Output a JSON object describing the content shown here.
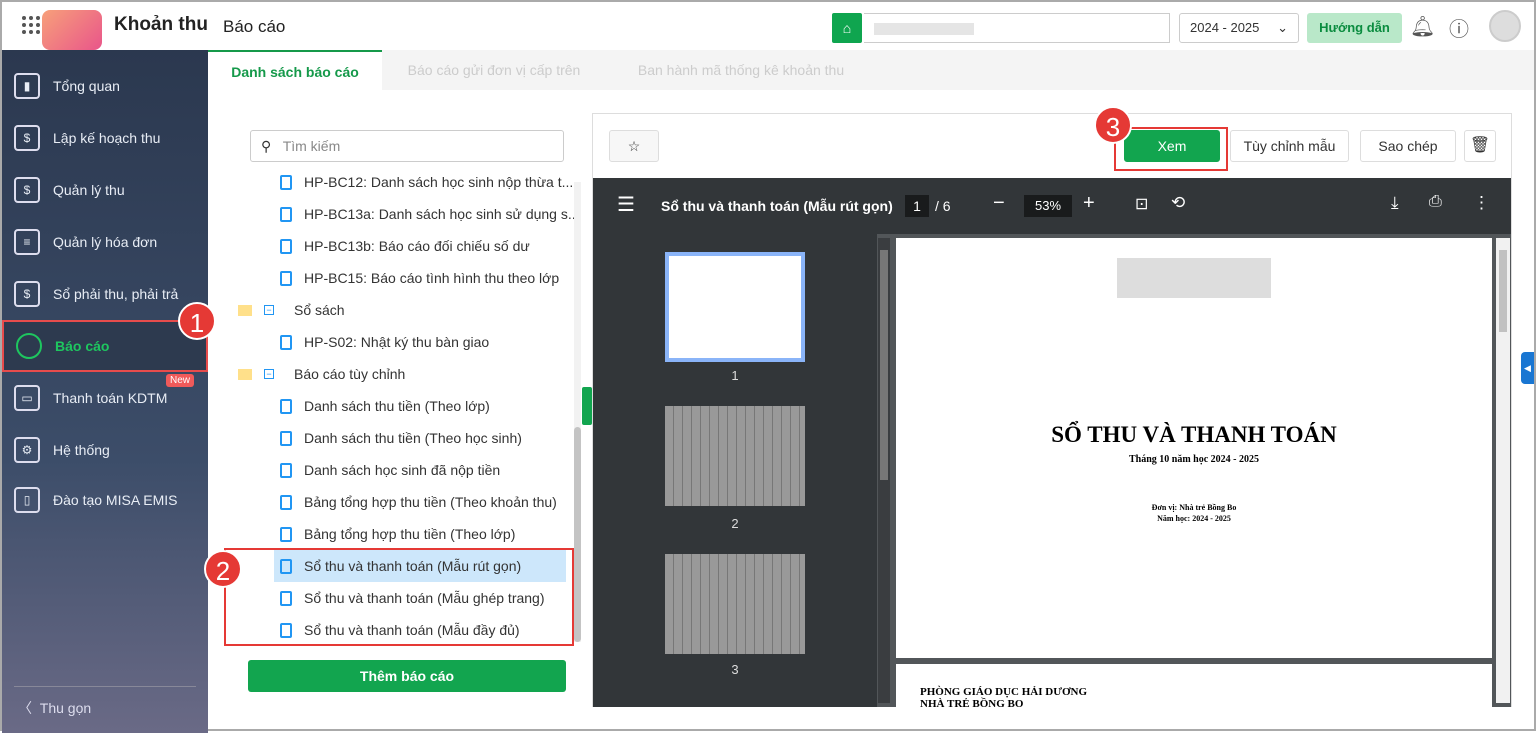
{
  "header": {
    "app_title": "Khoản thu",
    "page_title": "Báo cáo",
    "year": "2024 - 2025",
    "guide": "Hướng dẫn"
  },
  "sidebar": {
    "items": [
      {
        "label": "Tổng quan"
      },
      {
        "label": "Lập kế hoạch thu"
      },
      {
        "label": "Quản lý thu"
      },
      {
        "label": "Quản lý hóa đơn"
      },
      {
        "label": "Sổ phải thu, phải trả"
      },
      {
        "label": "Báo cáo"
      },
      {
        "label": "Thanh toán KDTM",
        "badge": "New"
      },
      {
        "label": "Hệ thống"
      },
      {
        "label": "Đào tạo MISA EMIS"
      }
    ],
    "collapse": "Thu gọn"
  },
  "tabs": [
    {
      "label": "Danh sách báo cáo"
    },
    {
      "label": "Báo cáo gửi đơn vị cấp trên"
    },
    {
      "label": "Ban hành mã thống kê khoản thu"
    }
  ],
  "tree": {
    "search_placeholder": "Tìm kiếm",
    "nodes": [
      "HP-BC12: Danh sách học sinh nộp thừa t...",
      "HP-BC13a: Danh sách học sinh sử dụng s...",
      "HP-BC13b: Báo cáo đối chiếu số dư",
      "HP-BC15: Báo cáo tình hình thu theo lớp",
      "Sổ sách",
      "HP-S02: Nhật ký thu bàn giao",
      "Báo cáo tùy chỉnh",
      "Danh sách thu tiền (Theo lớp)",
      "Danh sách thu tiền (Theo học sinh)",
      "Danh sách học sinh đã nộp tiền",
      "Bảng tổng hợp thu tiền (Theo khoản thu)",
      "Bảng tổng hợp thu tiền (Theo lớp)",
      "Sổ thu và thanh toán (Mẫu rút gọn)",
      "Sổ thu và thanh toán (Mẫu ghép trang)",
      "Sổ thu và thanh toán (Mẫu đầy đủ)"
    ],
    "add": "Thêm báo cáo"
  },
  "actions": {
    "view": "Xem",
    "customize": "Tùy chỉnh mẫu",
    "copy": "Sao chép"
  },
  "steps": [
    "1",
    "2",
    "3"
  ],
  "pdf": {
    "title": "Sổ thu và thanh toán (Mẫu rút gọn)",
    "page": "1",
    "total": "/ 6",
    "zoom": "53%",
    "thumbs": [
      "1",
      "2",
      "3"
    ],
    "doc_title": "SỔ THU VÀ THANH TOÁN",
    "doc_sub": "Tháng 10 năm học 2024 - 2025",
    "unit": "Đơn vị: Nhà trẻ Bồng Bo",
    "year": "Năm học: 2024 - 2025",
    "p2_line1": "PHÒNG GIÁO DỤC HẢI DƯƠNG",
    "p2_line2": "NHÀ TRẺ BỒNG BO"
  }
}
